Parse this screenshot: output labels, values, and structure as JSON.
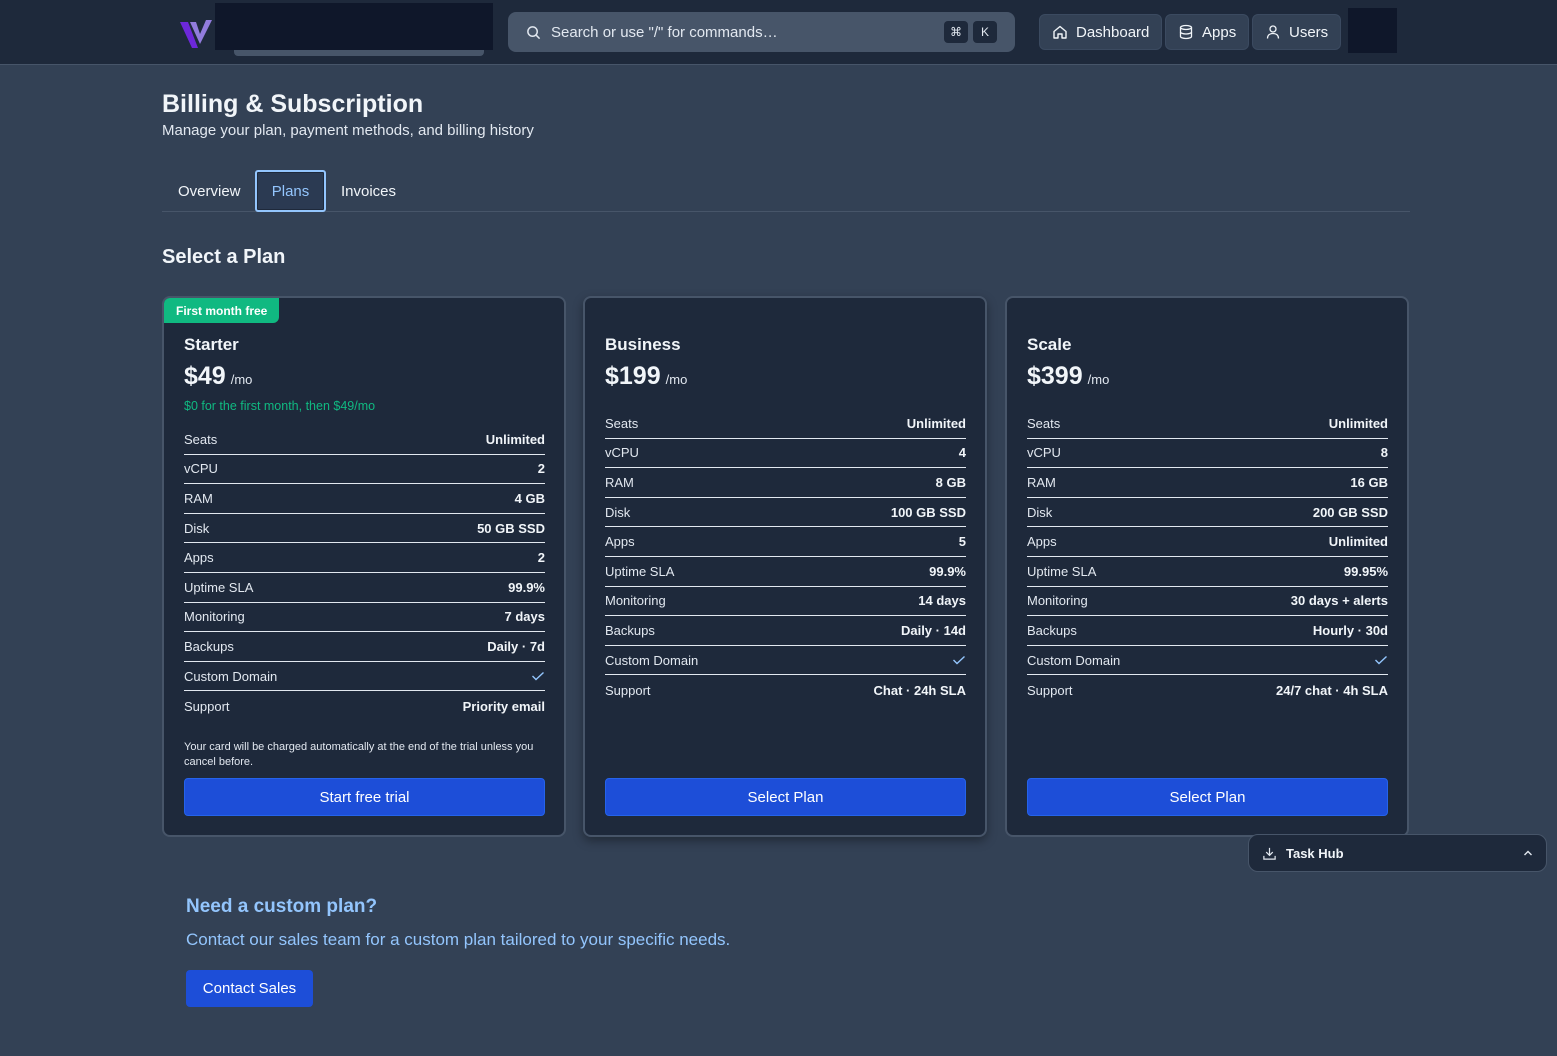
{
  "colors": {
    "accent": "#1d4ed8",
    "badge": "#10b981",
    "link": "#93c5fd",
    "background": "#334155",
    "card": "#1e293b"
  },
  "topbar": {
    "search_placeholder": "Search or use \"/\" for commands…",
    "shortcut_keys": [
      "⌘",
      "K"
    ],
    "nav": [
      {
        "label": "Dashboard",
        "icon": "home-icon"
      },
      {
        "label": "Apps",
        "icon": "database-icon"
      },
      {
        "label": "Users",
        "icon": "user-icon"
      }
    ]
  },
  "header": {
    "title": "Billing & Subscription",
    "subtitle": "Manage your plan, payment methods, and billing history"
  },
  "tabs": [
    {
      "label": "Overview",
      "active": false
    },
    {
      "label": "Plans",
      "active": true
    },
    {
      "label": "Invoices",
      "active": false
    }
  ],
  "section_title": "Select a Plan",
  "plans": [
    {
      "badge": "First month free",
      "name": "Starter",
      "price": "$49",
      "unit": "/mo",
      "promo": "$0 for the first month, then $49/mo",
      "features": [
        {
          "name": "Seats",
          "value": "Unlimited"
        },
        {
          "name": "vCPU",
          "value": "2"
        },
        {
          "name": "RAM",
          "value": "4 GB"
        },
        {
          "name": "Disk",
          "value": "50 GB SSD"
        },
        {
          "name": "Apps",
          "value": "2"
        },
        {
          "name": "Uptime SLA",
          "value": "99.9%"
        },
        {
          "name": "Monitoring",
          "value": "7 days"
        },
        {
          "name": "Backups",
          "value": "Daily · 7d"
        },
        {
          "name": "Custom Domain",
          "value": "",
          "check": true
        },
        {
          "name": "Support",
          "value": "Priority email"
        }
      ],
      "note": "Your card will be charged automatically at the end of the trial unless you cancel before.",
      "cta": "Start free trial"
    },
    {
      "name": "Business",
      "price": "$199",
      "unit": "/mo",
      "features": [
        {
          "name": "Seats",
          "value": "Unlimited"
        },
        {
          "name": "vCPU",
          "value": "4"
        },
        {
          "name": "RAM",
          "value": "8 GB"
        },
        {
          "name": "Disk",
          "value": "100 GB SSD"
        },
        {
          "name": "Apps",
          "value": "5"
        },
        {
          "name": "Uptime SLA",
          "value": "99.9%"
        },
        {
          "name": "Monitoring",
          "value": "14 days"
        },
        {
          "name": "Backups",
          "value": "Daily · 14d"
        },
        {
          "name": "Custom Domain",
          "value": "",
          "check": true
        },
        {
          "name": "Support",
          "value": "Chat · 24h SLA"
        }
      ],
      "cta": "Select Plan"
    },
    {
      "name": "Scale",
      "price": "$399",
      "unit": "/mo",
      "features": [
        {
          "name": "Seats",
          "value": "Unlimited"
        },
        {
          "name": "vCPU",
          "value": "8"
        },
        {
          "name": "RAM",
          "value": "16 GB"
        },
        {
          "name": "Disk",
          "value": "200 GB SSD"
        },
        {
          "name": "Apps",
          "value": "Unlimited"
        },
        {
          "name": "Uptime SLA",
          "value": "99.95%"
        },
        {
          "name": "Monitoring",
          "value": "30 days + alerts"
        },
        {
          "name": "Backups",
          "value": "Hourly · 30d"
        },
        {
          "name": "Custom Domain",
          "value": "",
          "check": true
        },
        {
          "name": "Support",
          "value": "24/7 chat · 4h SLA"
        }
      ],
      "cta": "Select Plan"
    }
  ],
  "task_hub": {
    "label": "Task Hub"
  },
  "custom_plan": {
    "title": "Need a custom plan?",
    "text": "Contact our sales team for a custom plan tailored to your specific needs.",
    "button": "Contact Sales"
  }
}
